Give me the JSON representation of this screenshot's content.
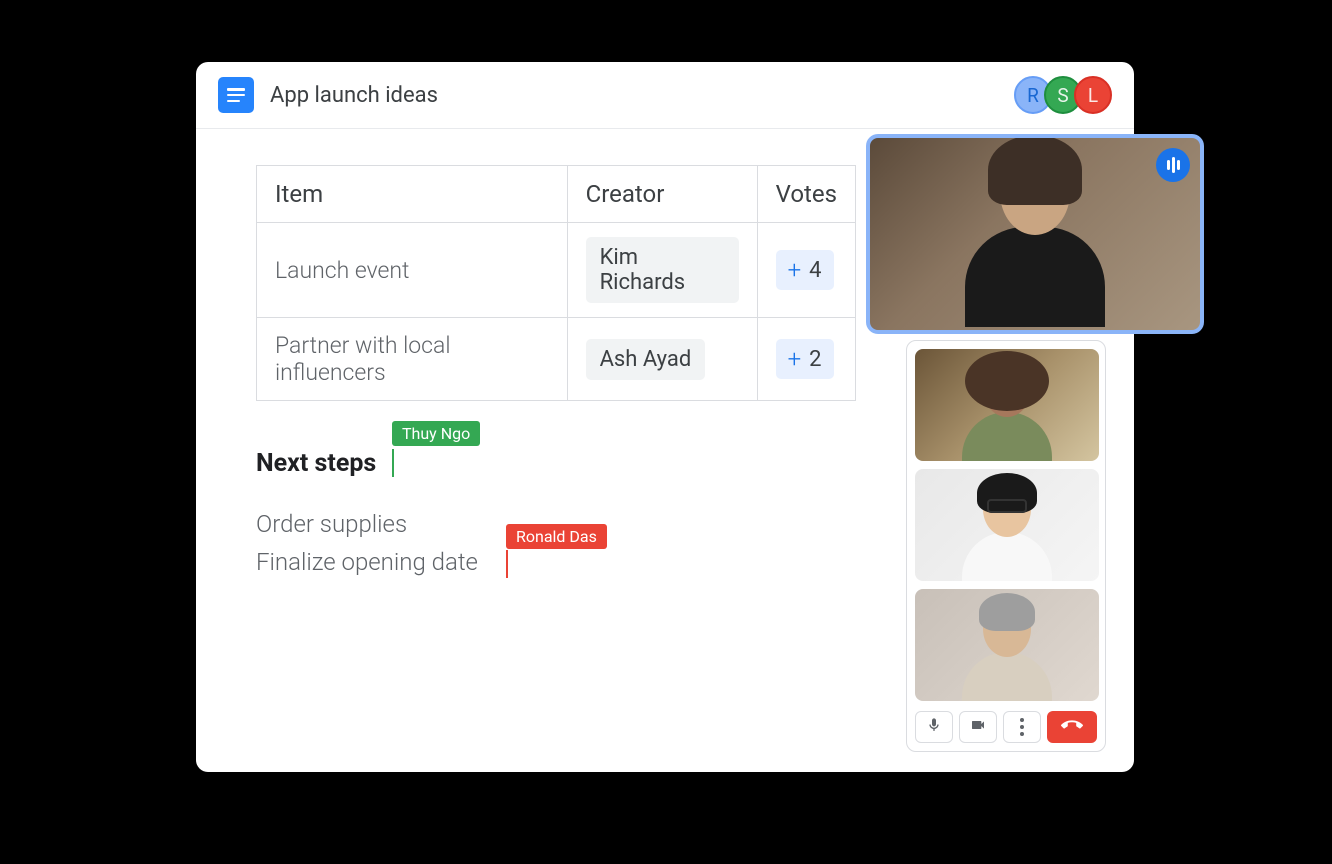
{
  "header": {
    "title": "App launch ideas",
    "collaborators": [
      {
        "initial": "R",
        "color": "blue"
      },
      {
        "initial": "S",
        "color": "green"
      },
      {
        "initial": "L",
        "color": "red"
      }
    ]
  },
  "table": {
    "headers": {
      "item": "Item",
      "creator": "Creator",
      "votes": "Votes"
    },
    "rows": [
      {
        "item": "Launch event",
        "creator": "Kim Richards",
        "votes": "4"
      },
      {
        "item": "Partner with local influencers",
        "creator": "Ash Ayad",
        "votes": "2"
      }
    ]
  },
  "section": {
    "heading": "Next steps",
    "lines": {
      "line1": "Order supplies",
      "line2": "Finalize opening date"
    }
  },
  "cursors": {
    "green_user": "Thuy Ngo",
    "red_user": "Ronald Das"
  },
  "vote_plus": "+"
}
